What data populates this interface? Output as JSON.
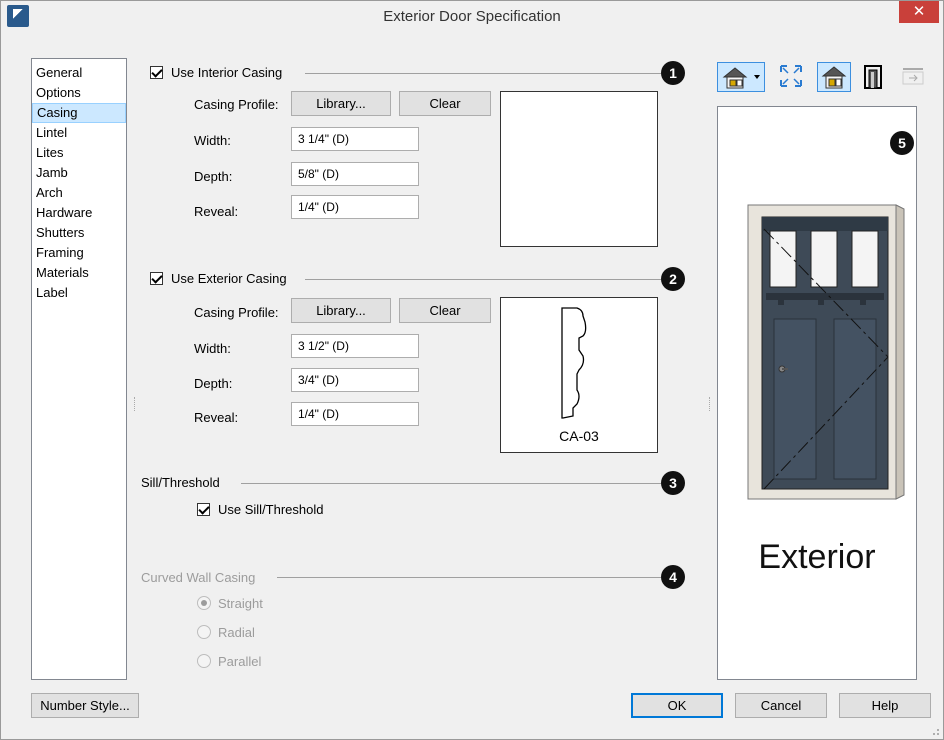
{
  "window": {
    "title": "Exterior Door Specification",
    "close": "✕"
  },
  "nav": {
    "items": [
      "General",
      "Options",
      "Casing",
      "Lintel",
      "Lites",
      "Jamb",
      "Arch",
      "Hardware",
      "Shutters",
      "Framing",
      "Materials",
      "Label"
    ],
    "selected": "Casing"
  },
  "interior_casing": {
    "checkbox_label": "Use Interior Casing",
    "checked": true,
    "callout": "1",
    "profile_label": "Casing Profile:",
    "library_btn": "Library...",
    "clear_btn": "Clear",
    "width_label": "Width:",
    "width_value": "3 1/4\" (D)",
    "depth_label": "Depth:",
    "depth_value": "5/8\" (D)",
    "reveal_label": "Reveal:",
    "reveal_value": "1/4\" (D)"
  },
  "exterior_casing": {
    "checkbox_label": "Use Exterior Casing",
    "checked": true,
    "callout": "2",
    "profile_label": "Casing Profile:",
    "library_btn": "Library...",
    "clear_btn": "Clear",
    "width_label": "Width:",
    "width_value": "3 1/2\" (D)",
    "depth_label": "Depth:",
    "depth_value": "3/4\" (D)",
    "reveal_label": "Reveal:",
    "reveal_value": "1/4\" (D)",
    "profile_name": "CA-03"
  },
  "sill": {
    "section_label": "Sill/Threshold",
    "callout": "3",
    "checkbox_label": "Use Sill/Threshold",
    "checked": true
  },
  "curved_wall": {
    "section_label": "Curved Wall Casing",
    "callout": "4",
    "options": [
      "Straight",
      "Radial",
      "Parallel"
    ],
    "selected": "Straight",
    "disabled": true
  },
  "preview": {
    "callout": "5",
    "caption": "Exterior",
    "door_color": "#3e4a57"
  },
  "footer": {
    "number_style_btn": "Number Style...",
    "ok_btn": "OK",
    "cancel_btn": "Cancel",
    "help_btn": "Help"
  },
  "toolbar": {
    "icons": [
      "house-view-icon",
      "fill-window-icon",
      "color-mode-icon",
      "door-casing-icon",
      "reverse-swing-icon"
    ]
  }
}
